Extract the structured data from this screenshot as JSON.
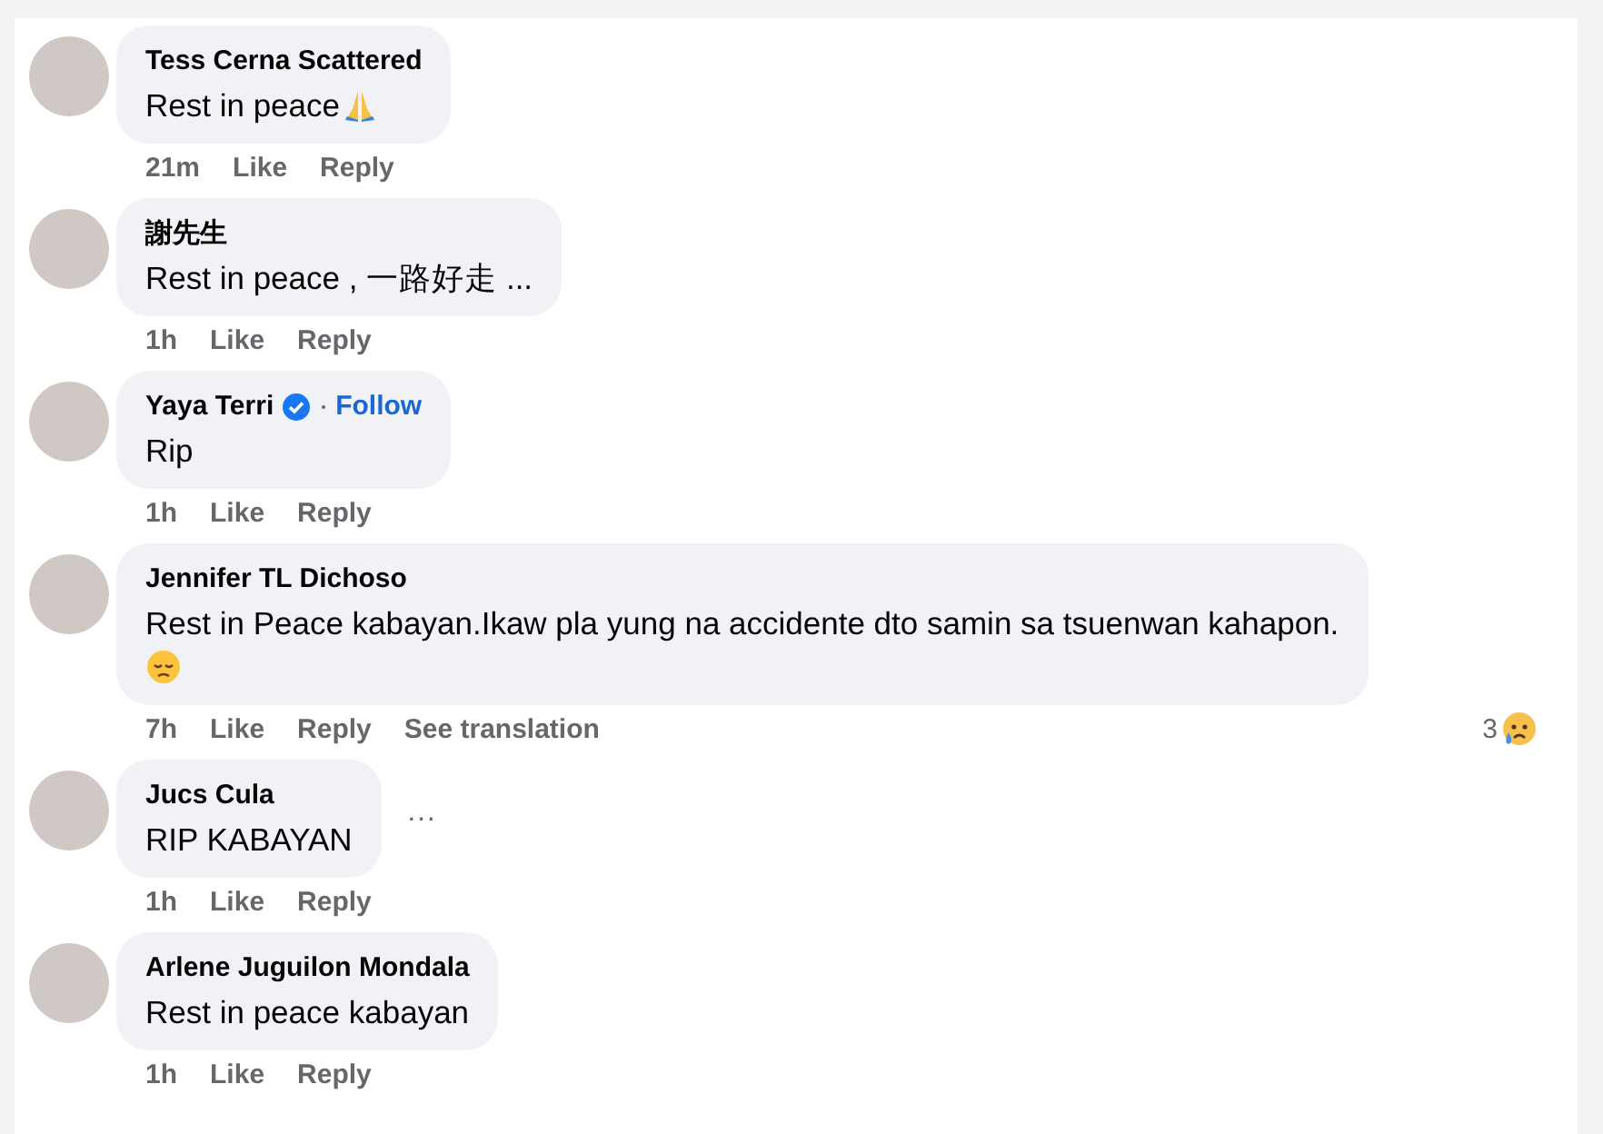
{
  "comments": [
    {
      "author": "Tess Cerna Scattered",
      "text": "Rest in peace",
      "time": "21m",
      "actions": [
        "Like",
        "Reply"
      ]
    },
    {
      "author": "謝先生",
      "text": "Rest in peace , 一路好走 ...",
      "time": "1h",
      "actions": [
        "Like",
        "Reply"
      ]
    },
    {
      "author": "Yaya Terri",
      "verified": true,
      "follow": "Follow",
      "text": "Rip",
      "time": "1h",
      "actions": [
        "Like",
        "Reply"
      ]
    },
    {
      "author": "Jennifer TL Dichoso",
      "text": "Rest in Peace kabayan.Ikaw pla yung na accidente dto samin sa tsuenwan kahapon.",
      "time": "7h",
      "actions": [
        "Like",
        "Reply",
        "See translation"
      ],
      "reaction": {
        "count": "3",
        "kind": "sad"
      }
    },
    {
      "author": "Jucs Cula",
      "text": "RIP KABAYAN",
      "more": "···",
      "time": "1h",
      "actions": [
        "Like",
        "Reply"
      ]
    },
    {
      "author": "Arlene Juguilon Mondala",
      "text": "Rest in peace kabayan",
      "time": "1h",
      "actions": [
        "Like",
        "Reply"
      ]
    }
  ]
}
